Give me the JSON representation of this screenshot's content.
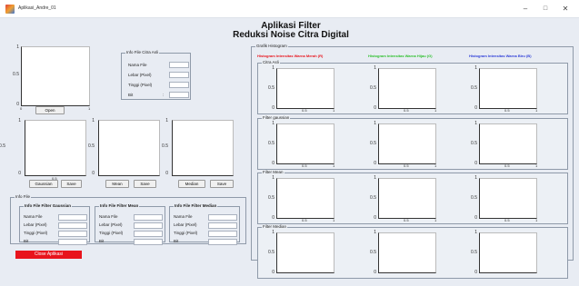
{
  "window": {
    "title": "Aplikasi_Andre_01",
    "minimize": "–",
    "maximize": "□",
    "close": "✕"
  },
  "heading": {
    "line1": "Aplikasi Filter",
    "line2": "Reduksi Noise Citra Digital"
  },
  "axes_ticks": {
    "y_top": "1",
    "y_mid": "0.5",
    "y_bot": "0",
    "x_left": "0",
    "x_mid": "0.5",
    "x_right": "1"
  },
  "main_axes": {
    "open_label": "Open"
  },
  "info_citra_asli": {
    "title": "Info File Citra Asli",
    "rows": [
      {
        "label": "Nama File",
        "value": ""
      },
      {
        "label": "Lebar (Pixel)",
        "value": ""
      },
      {
        "label": "Tinggi (Pixel)",
        "value": ""
      },
      {
        "label": "Bit",
        "value": ""
      }
    ]
  },
  "filters": [
    {
      "button": "Gaussian",
      "save": "Save"
    },
    {
      "button": "Mean",
      "save": "Save"
    },
    {
      "button": "Median",
      "save": "Save"
    }
  ],
  "info_file": {
    "title": "Info File",
    "panels": [
      {
        "title": "Info File Filter Gaussian"
      },
      {
        "title": "Info File Filter Mean"
      },
      {
        "title": "Info File Filter Median"
      }
    ],
    "labels": [
      "Nama File",
      "Lebar (Pixel)",
      "Tinggi (Pixel)",
      "Bit"
    ]
  },
  "histogram": {
    "title": "Grafik Histogram",
    "columns": [
      {
        "title": "Histogram Intensitas Warna Merah (R)",
        "color": "#e8141c"
      },
      {
        "title": "Histogram Intensitas Warna Hijau (G)",
        "color": "#2ec02e"
      },
      {
        "title": "Histogram Intensitas Warna Biru (B)",
        "color": "#3040d8"
      }
    ],
    "rows": [
      "Citra Asli",
      "Filter gaussian",
      "Filter Mean",
      "Filter Median"
    ]
  },
  "close_app": "Close Aplikasi"
}
